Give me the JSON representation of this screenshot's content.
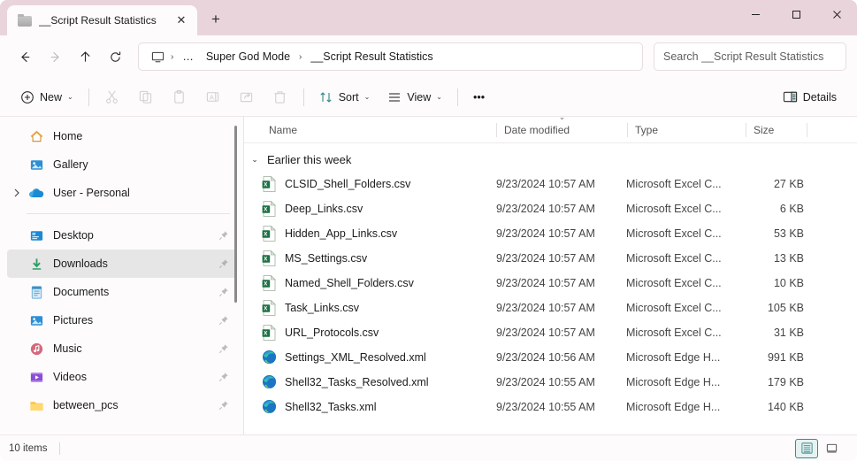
{
  "window": {
    "tab_title": "__Script Result Statistics",
    "tab_icon": "folder-icon",
    "close_tab_glyph": "✕",
    "new_tab_glyph": "+",
    "minimize_glyph": "—",
    "maximize_glyph": "☐",
    "close_glyph": "✕",
    "accent_color": "#e9d4dc",
    "teal_accent": "#3b8a8a"
  },
  "addressbar": {
    "back_glyph": "←",
    "forward_glyph": "→",
    "up_glyph": "↑",
    "refresh_glyph": "⟳",
    "breadcrumb": {
      "root_icon": "this-pc-monitor-icon",
      "separator": "›",
      "overflow": "…",
      "items": [
        "Super God Mode",
        "__Script Result Statistics"
      ]
    },
    "search_placeholder": "Search __Script Result Statistics",
    "search_value": ""
  },
  "toolbar": {
    "new_label": "New",
    "new_icon": "plus-circle-icon",
    "cut_icon": "scissors-icon",
    "copy_icon": "copy-icon",
    "paste_icon": "clipboard-icon",
    "rename_icon": "rename-icon",
    "share_icon": "share-icon",
    "delete_icon": "trash-icon",
    "sort_label": "Sort",
    "sort_icon": "sort-arrows-icon",
    "view_label": "View",
    "view_icon": "list-lines-icon",
    "more_label": "•••",
    "details_label": "Details",
    "details_icon": "details-pane-icon",
    "chevron": "⌄"
  },
  "sidebar": {
    "groups": [
      {
        "items": [
          {
            "label": "Home",
            "icon": "home-icon",
            "pinned": false,
            "expandable": false,
            "active": false
          },
          {
            "label": "Gallery",
            "icon": "gallery-icon",
            "pinned": false,
            "expandable": false,
            "active": false
          },
          {
            "label": "User - Personal",
            "icon": "onedrive-cloud-icon",
            "pinned": false,
            "expandable": true,
            "active": false
          }
        ]
      },
      {
        "items": [
          {
            "label": "Desktop",
            "icon": "desktop-icon",
            "pinned": true,
            "expandable": false,
            "active": false
          },
          {
            "label": "Downloads",
            "icon": "downloads-icon",
            "pinned": true,
            "expandable": false,
            "active": true
          },
          {
            "label": "Documents",
            "icon": "documents-icon",
            "pinned": true,
            "expandable": false,
            "active": false
          },
          {
            "label": "Pictures",
            "icon": "pictures-icon",
            "pinned": true,
            "expandable": false,
            "active": false
          },
          {
            "label": "Music",
            "icon": "music-icon",
            "pinned": true,
            "expandable": false,
            "active": false
          },
          {
            "label": "Videos",
            "icon": "videos-icon",
            "pinned": true,
            "expandable": false,
            "active": false
          },
          {
            "label": "between_pcs",
            "icon": "folder-icon",
            "pinned": true,
            "expandable": false,
            "active": false
          }
        ]
      }
    ]
  },
  "filelist": {
    "columns": [
      {
        "label": "Name",
        "sorted": false
      },
      {
        "label": "Date modified",
        "sorted": true,
        "sort_glyph": "⌄"
      },
      {
        "label": "Type",
        "sorted": false
      },
      {
        "label": "Size",
        "sorted": false
      }
    ],
    "group": {
      "label": "Earlier this week",
      "chevron": "⌄",
      "expanded": true
    },
    "rows": [
      {
        "name": "CLSID_Shell_Folders.csv",
        "date": "9/23/2024 10:57 AM",
        "type": "Microsoft Excel C...",
        "size": "27 KB",
        "icon": "excel-csv-icon"
      },
      {
        "name": "Deep_Links.csv",
        "date": "9/23/2024 10:57 AM",
        "type": "Microsoft Excel C...",
        "size": "6 KB",
        "icon": "excel-csv-icon"
      },
      {
        "name": "Hidden_App_Links.csv",
        "date": "9/23/2024 10:57 AM",
        "type": "Microsoft Excel C...",
        "size": "53 KB",
        "icon": "excel-csv-icon"
      },
      {
        "name": "MS_Settings.csv",
        "date": "9/23/2024 10:57 AM",
        "type": "Microsoft Excel C...",
        "size": "13 KB",
        "icon": "excel-csv-icon"
      },
      {
        "name": "Named_Shell_Folders.csv",
        "date": "9/23/2024 10:57 AM",
        "type": "Microsoft Excel C...",
        "size": "10 KB",
        "icon": "excel-csv-icon"
      },
      {
        "name": "Task_Links.csv",
        "date": "9/23/2024 10:57 AM",
        "type": "Microsoft Excel C...",
        "size": "105 KB",
        "icon": "excel-csv-icon"
      },
      {
        "name": "URL_Protocols.csv",
        "date": "9/23/2024 10:57 AM",
        "type": "Microsoft Excel C...",
        "size": "31 KB",
        "icon": "excel-csv-icon"
      },
      {
        "name": "Settings_XML_Resolved.xml",
        "date": "9/23/2024 10:56 AM",
        "type": "Microsoft Edge H...",
        "size": "991 KB",
        "icon": "edge-icon"
      },
      {
        "name": "Shell32_Tasks_Resolved.xml",
        "date": "9/23/2024 10:55 AM",
        "type": "Microsoft Edge H...",
        "size": "179 KB",
        "icon": "edge-icon"
      },
      {
        "name": "Shell32_Tasks.xml",
        "date": "9/23/2024 10:55 AM",
        "type": "Microsoft Edge H...",
        "size": "140 KB",
        "icon": "edge-icon"
      }
    ]
  },
  "statusbar": {
    "item_count": "10 items",
    "details_view_icon": "details-view-icon",
    "large_icons_view_icon": "large-icons-view-icon",
    "selected_view": "details"
  }
}
